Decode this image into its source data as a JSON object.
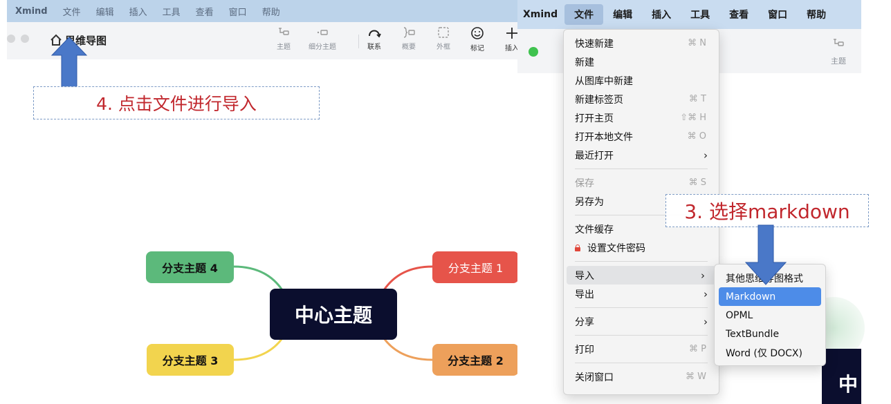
{
  "colors": {
    "annotation_red": "#c1272d",
    "arrow_blue": "#4a78c8",
    "central_bg": "#0b0e2e",
    "topic1": "#e6544a",
    "topic2": "#eda05b",
    "topic3": "#f2d44e",
    "topic4": "#5cb97b",
    "selection_blue": "#4d8ce8"
  },
  "left": {
    "menubar": {
      "app": "Xmind",
      "items": [
        "文件",
        "编辑",
        "插入",
        "工具",
        "查看",
        "窗口",
        "帮助"
      ]
    },
    "toolbar": {
      "doc_title": "思维导图",
      "items": [
        {
          "label": "主题",
          "icon": "topic-icon"
        },
        {
          "label": "细分主题",
          "icon": "subtopic-icon"
        },
        {
          "label": "联系",
          "icon": "relationship-icon"
        },
        {
          "label": "概要",
          "icon": "summary-icon"
        },
        {
          "label": "外框",
          "icon": "boundary-icon"
        },
        {
          "label": "标记",
          "icon": "marker-icon"
        },
        {
          "label": "插入",
          "icon": "insert-icon"
        }
      ]
    },
    "annotation": "4. 点击文件进行导入",
    "mindmap": {
      "central": "中心主题",
      "branches": [
        "分支主题 1",
        "分支主题 2",
        "分支主题 3",
        "分支主题 4"
      ]
    }
  },
  "right": {
    "menubar": {
      "app": "Xmind",
      "items": [
        "文件",
        "编辑",
        "插入",
        "工具",
        "查看",
        "窗口",
        "帮助"
      ],
      "active": "文件"
    },
    "toolbar": {
      "item_label": "主题"
    },
    "file_menu": {
      "quick_new": {
        "label": "快速新建",
        "shortcut": "⌘ N"
      },
      "new": {
        "label": "新建"
      },
      "new_from_gallery": {
        "label": "从图库中新建"
      },
      "new_tab": {
        "label": "新建标签页",
        "shortcut": "⌘ T"
      },
      "open_home": {
        "label": "打开主页",
        "shortcut": "⇧⌘ H"
      },
      "open_local": {
        "label": "打开本地文件",
        "shortcut": "⌘ O"
      },
      "recent": {
        "label": "最近打开"
      },
      "save": {
        "label": "保存",
        "shortcut": "⌘ S"
      },
      "save_as": {
        "label": "另存为"
      },
      "file_cache": {
        "label": "文件缓存"
      },
      "set_password": {
        "label": "设置文件密码"
      },
      "import": {
        "label": "导入"
      },
      "export": {
        "label": "导出"
      },
      "share": {
        "label": "分享"
      },
      "print": {
        "label": "打印",
        "shortcut": "⌘ P"
      },
      "close_window": {
        "label": "关闭窗口",
        "shortcut": "⌘ W"
      }
    },
    "import_submenu": [
      "其他思维导图格式",
      "Markdown",
      "OPML",
      "TextBundle",
      "Word (仅 DOCX)"
    ],
    "import_submenu_selected": "Markdown",
    "annotation": "3. 选择markdown",
    "canvas_partial_text": "中"
  }
}
